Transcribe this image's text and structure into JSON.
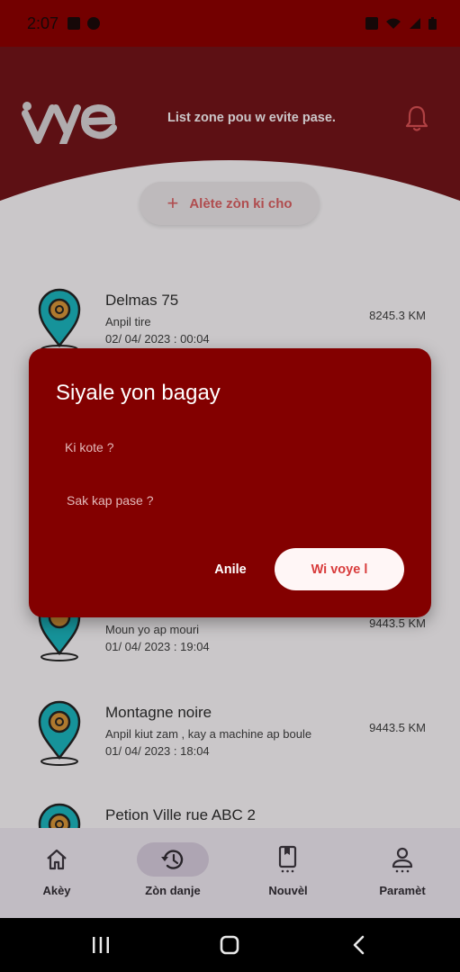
{
  "status_bar": {
    "time": "2:07"
  },
  "header": {
    "logo_text": "vye",
    "subtitle": "List zone pou w evite pase."
  },
  "report_button": {
    "label": "Alète zòn ki cho"
  },
  "zones": [
    {
      "name": "Delmas 75",
      "description": "Anpil tire",
      "date": "02/ 04/ 2023 : 00:04",
      "distance": "8245.3 KM"
    },
    {
      "name": "",
      "description": "Moun yo ap mouri",
      "date": "01/ 04/ 2023 : 19:04",
      "distance": "9443.5 KM"
    },
    {
      "name": "Montagne noire",
      "description": "Anpil kiut zam , kay a machine ap boule",
      "date": "01/ 04/ 2023 : 18:04",
      "distance": "9443.5 KM"
    },
    {
      "name": "Petion Ville rue ABC 2",
      "description": "",
      "date": "",
      "distance": ""
    }
  ],
  "dialog": {
    "title": "Siyale yon bagay",
    "where_placeholder": "Ki kote ?",
    "what_placeholder": "Sak kap pase ?",
    "cancel_label": "Anile",
    "confirm_label": "Wi voye l"
  },
  "bottom_nav": [
    {
      "label": "Akèy",
      "icon": "home-icon"
    },
    {
      "label": "Zòn danje",
      "icon": "history-icon",
      "active": true
    },
    {
      "label": "Nouvèl",
      "icon": "book-icon"
    },
    {
      "label": "Paramèt",
      "icon": "person-icon"
    }
  ],
  "colors": {
    "brand_red": "#830000",
    "header_dark": "#6a1317",
    "pin_teal": "#1aa8b0",
    "pin_orange": "#c88a35"
  }
}
